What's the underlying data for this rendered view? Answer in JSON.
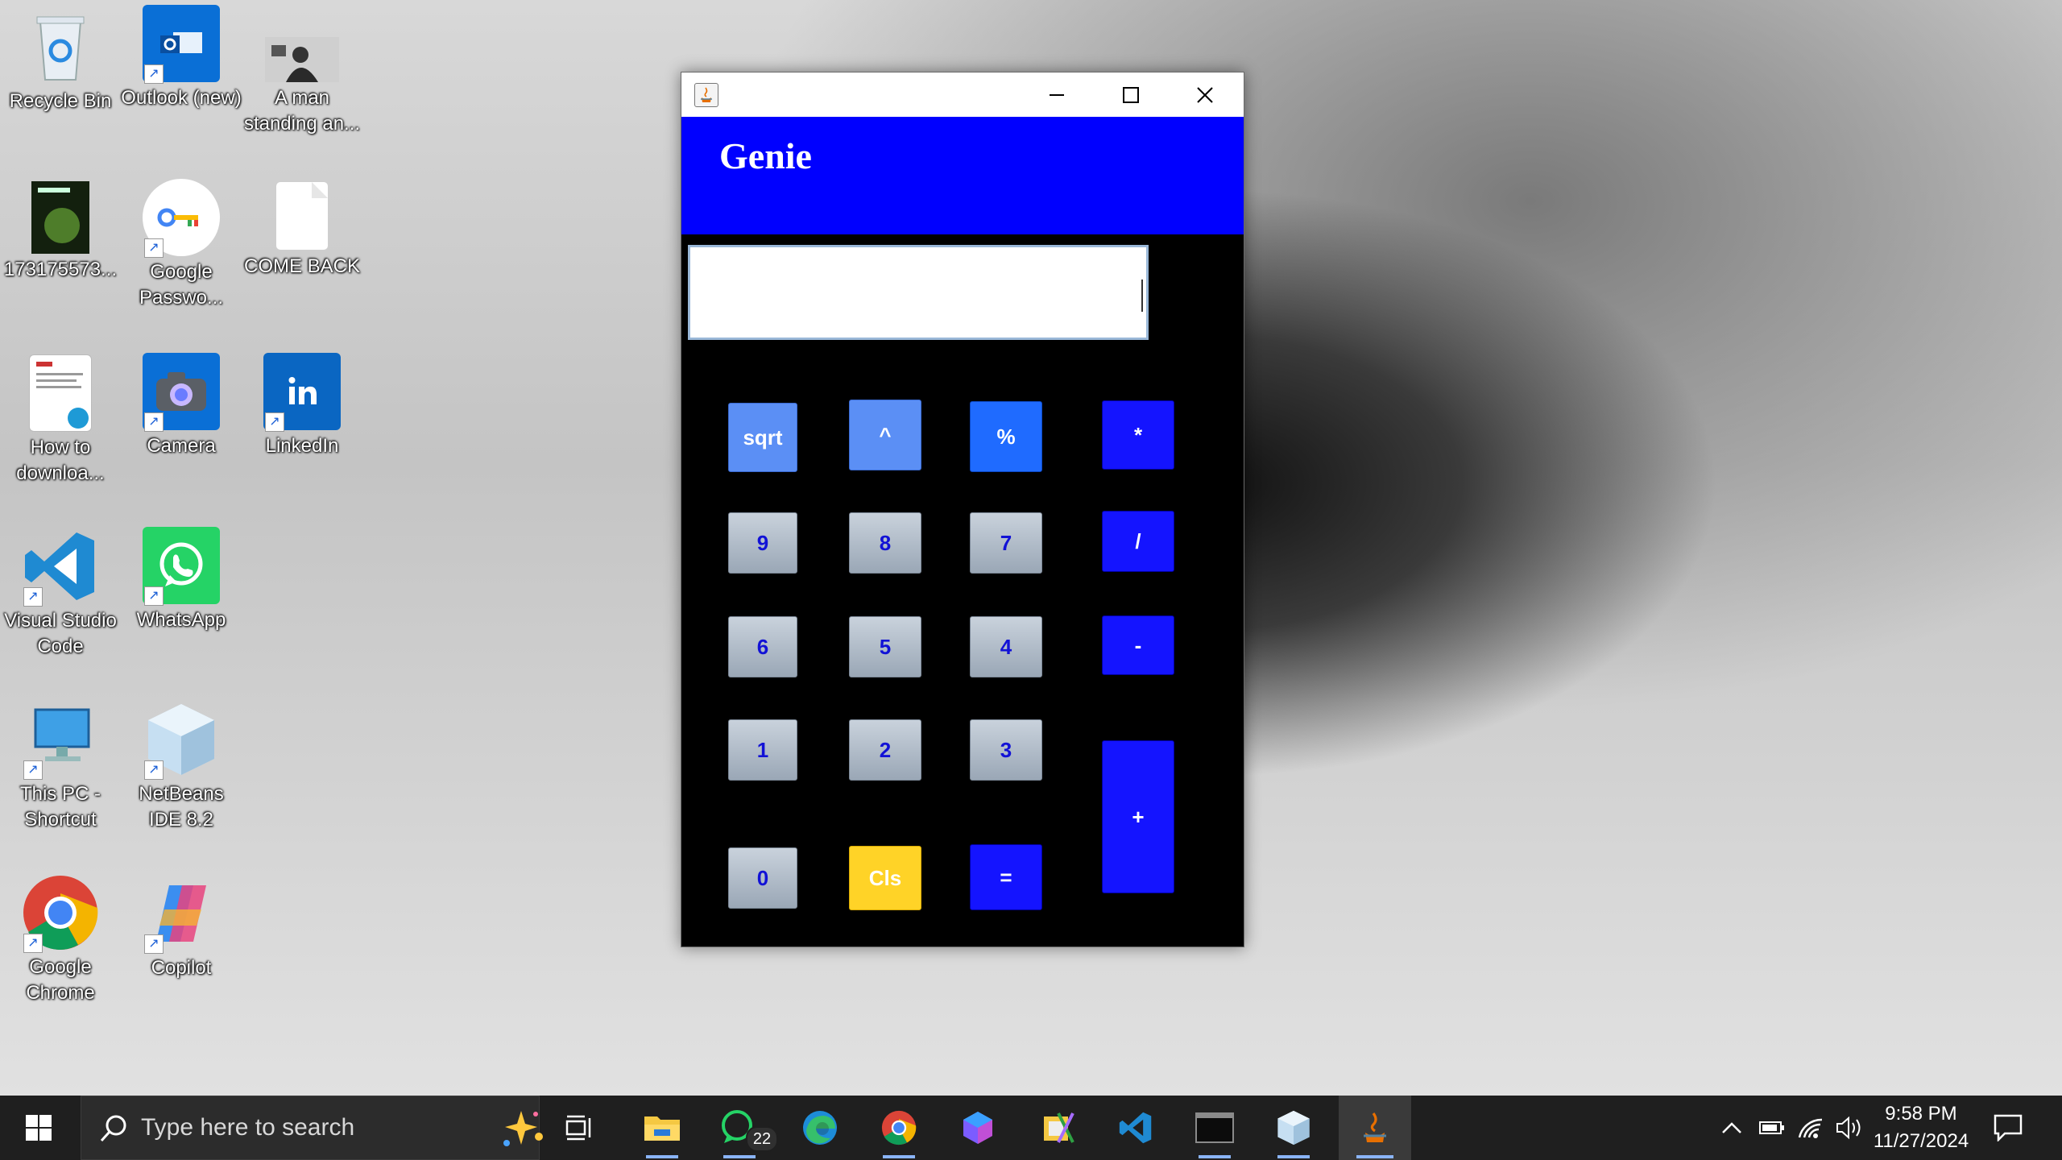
{
  "desktop": {
    "icons": [
      {
        "label": "Recycle Bin"
      },
      {
        "label": "Outlook (new)"
      },
      {
        "label": "A man standing an..."
      },
      {
        "label": "173175573..."
      },
      {
        "label": "Google Passwo..."
      },
      {
        "label": "COME BACK"
      },
      {
        "label": "How to downloa..."
      },
      {
        "label": "Camera"
      },
      {
        "label": "LinkedIn"
      },
      {
        "label": "Visual Studio Code"
      },
      {
        "label": "WhatsApp"
      },
      {
        "label": "This PC - Shortcut"
      },
      {
        "label": "NetBeans IDE 8.2"
      },
      {
        "label": "Google Chrome"
      },
      {
        "label": "Copilot"
      }
    ]
  },
  "window": {
    "header_title": "Genie",
    "display_value": "",
    "keys": {
      "sqrt": "sqrt",
      "pow": "^",
      "percent": "%",
      "multiply": "*",
      "nine": "9",
      "eight": "8",
      "seven": "7",
      "divide": "/",
      "six": "6",
      "five": "5",
      "four": "4",
      "minus": "-",
      "one": "1",
      "two": "2",
      "three": "3",
      "plus": "+",
      "zero": "0",
      "cls": "Cls",
      "equals": "="
    }
  },
  "taskbar": {
    "search_placeholder": "Type here to search",
    "whatsapp_badge": "22",
    "time": "9:58 PM",
    "date": "11/27/2024"
  },
  "colors": {
    "header_blue": "#0000ff",
    "key_blue": "#1414ff",
    "cls_yellow": "#ffd327"
  }
}
